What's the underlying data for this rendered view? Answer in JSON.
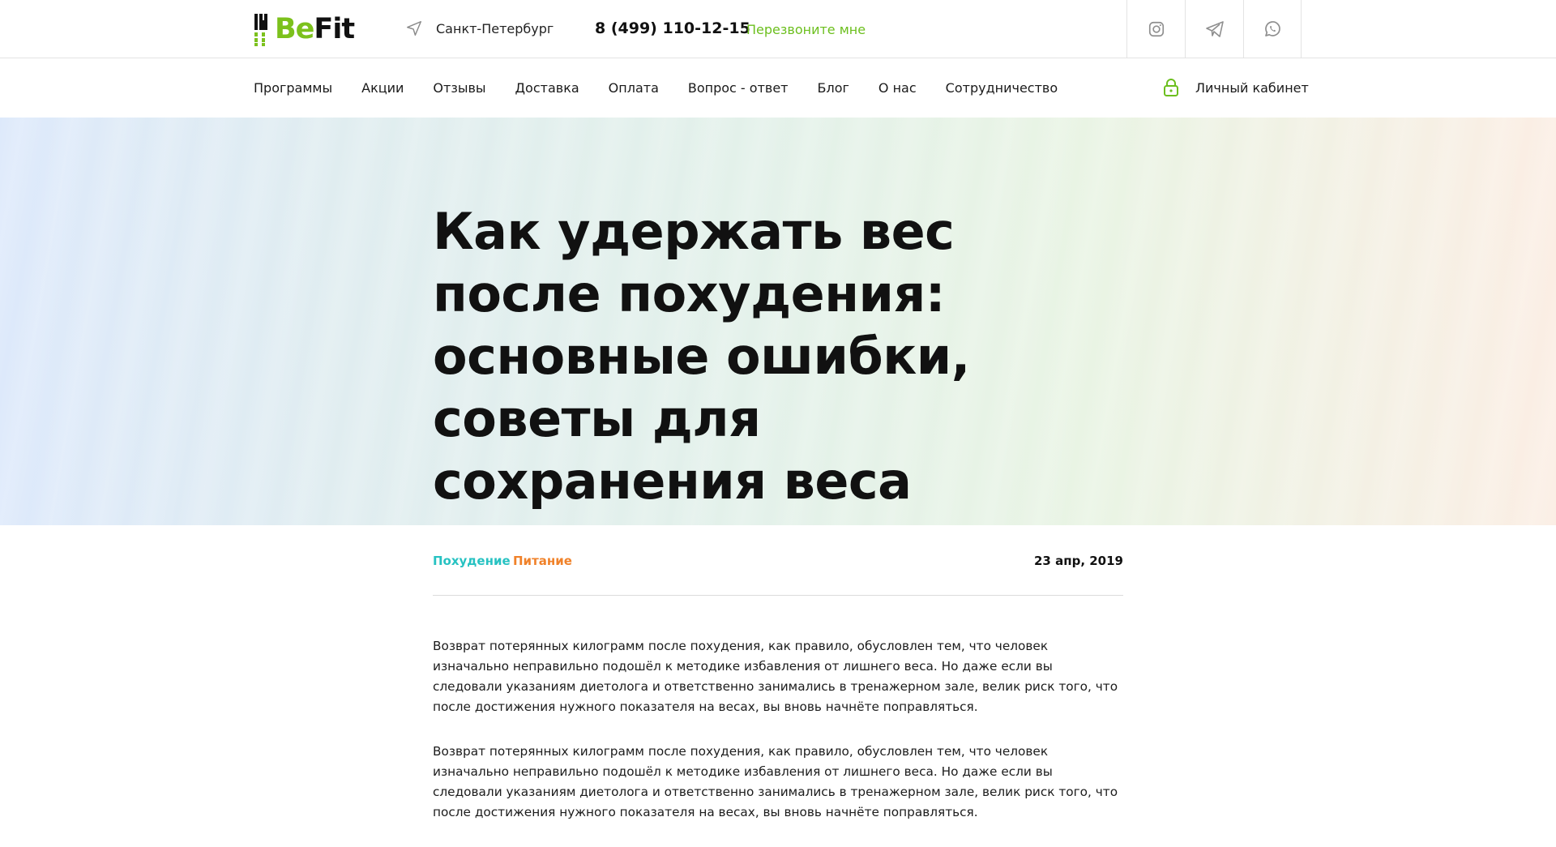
{
  "header": {
    "logo": {
      "be": "Be",
      "fit": "Fit"
    },
    "city": "Санкт-Петербург",
    "phone": "8 (499) 110-12-15",
    "callback": "Перезвоните мне",
    "socials": [
      "instagram-icon",
      "telegram-icon",
      "whatsapp-icon"
    ],
    "accent_color": "#7cc11c"
  },
  "nav": {
    "items": [
      "Программы",
      "Акции",
      "Отзывы",
      "Доставка",
      "Оплата",
      "Вопрос - ответ",
      "Блог",
      "О нас",
      "Сотрудничество"
    ],
    "cabinet": "Личный кабинет"
  },
  "hero": {
    "title": "Как удержать вес после похудения: основные ошибки, советы для сохранения веса"
  },
  "meta": {
    "tags": [
      {
        "label": "Похудение",
        "color": "#27c2c2"
      },
      {
        "label": "Питание",
        "color": "#f0822a"
      }
    ],
    "date": "23 апр, 2019"
  },
  "article": {
    "paragraphs": [
      "Возврат потерянных килограмм после похудения, как правило, обусловлен тем, что человек изначально неправильно подошёл к методике избавления от лишнего веса. Но даже если вы следовали указаниям диетолога и ответственно занимались в тренажерном зале, велик риск того, что после достижения нужного показателя на весах, вы вновь начнёте поправляться.",
      "Возврат потерянных килограмм после похудения, как правило, обусловлен тем, что человек изначально неправильно подошёл к методике избавления от лишнего веса. Но даже если вы следовали указаниям диетолога и ответственно занимались в тренажерном зале, велик риск того, что после достижения нужного показателя на весах, вы вновь начнёте поправляться."
    ]
  }
}
